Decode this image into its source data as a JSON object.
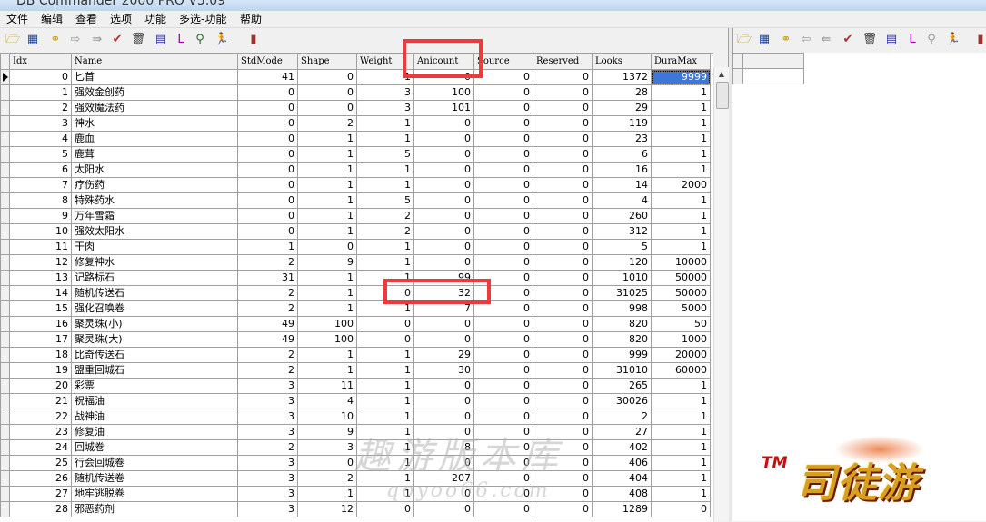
{
  "window": {
    "title": "DB Commander 2000 PRO V5.09"
  },
  "menu": [
    "文件",
    "编辑",
    "查看",
    "选项",
    "功能",
    "多选-功能",
    "帮助"
  ],
  "toolbar_left": [
    {
      "name": "open-folder-icon",
      "glyph": "🗁",
      "color": "#b8860b"
    },
    {
      "name": "grid-view-icon",
      "glyph": "▦",
      "color": "#1f3f8f"
    },
    {
      "name": "binoculars-icon",
      "glyph": "⚭",
      "color": "#c7a400"
    },
    {
      "name": "arrow-right-icon",
      "glyph": "⇨",
      "color": "#999999"
    },
    {
      "name": "export-icon",
      "glyph": "⇛",
      "color": "#999999"
    },
    {
      "name": "checklist-icon",
      "glyph": "✔",
      "color": "#b03030"
    },
    {
      "name": "trash-icon",
      "glyph": "🗑",
      "color": "#333333"
    },
    {
      "name": "database-icon",
      "glyph": "▤",
      "color": "#3030a0"
    },
    {
      "name": "letter-l-icon",
      "glyph": "L",
      "color": "#a000a0"
    },
    {
      "name": "search-key-icon",
      "glyph": "⚲",
      "color": "#2a6a2a"
    },
    {
      "name": "running-man-icon",
      "glyph": "🏃",
      "color": "#10a010"
    },
    {
      "name": "exit-door-icon",
      "glyph": "▮",
      "color": "#a03030"
    }
  ],
  "toolbar_right": [
    {
      "name": "open-folder-icon",
      "glyph": "🗁",
      "color": "#b8860b"
    },
    {
      "name": "grid-view-icon",
      "glyph": "▦",
      "color": "#1f3f8f"
    },
    {
      "name": "binoculars-icon",
      "glyph": "⚭",
      "color": "#c7a400"
    },
    {
      "name": "arrow-left-icon",
      "glyph": "⇦",
      "color": "#999999"
    },
    {
      "name": "import-icon",
      "glyph": "⇚",
      "color": "#999999"
    },
    {
      "name": "checklist-icon",
      "glyph": "✔",
      "color": "#b03030"
    },
    {
      "name": "trash-icon",
      "glyph": "🗑",
      "color": "#333333"
    },
    {
      "name": "database-icon",
      "glyph": "▤",
      "color": "#3030a0"
    },
    {
      "name": "letter-l-icon",
      "glyph": "L",
      "color": "#a000a0"
    },
    {
      "name": "search-key-icon",
      "glyph": "⚲",
      "color": "#999999"
    },
    {
      "name": "running-man-icon",
      "glyph": "🏃",
      "color": "#10a010"
    },
    {
      "name": "exit-door-icon",
      "glyph": "▮",
      "color": "#a03030"
    }
  ],
  "table": {
    "columns": [
      "Idx",
      "Name",
      "StdMode",
      "Shape",
      "Weight",
      "Anicount",
      "Source",
      "Reserved",
      "Looks",
      "DuraMax"
    ],
    "rows": [
      [
        "0",
        "匕首",
        "41",
        "0",
        "1",
        "0",
        "0",
        "0",
        "1372",
        "9999"
      ],
      [
        "1",
        "强效金创药",
        "0",
        "0",
        "3",
        "100",
        "0",
        "0",
        "28",
        "1"
      ],
      [
        "2",
        "强效魔法药",
        "0",
        "0",
        "3",
        "101",
        "0",
        "0",
        "29",
        "1"
      ],
      [
        "3",
        "神水",
        "0",
        "2",
        "1",
        "0",
        "0",
        "0",
        "119",
        "1"
      ],
      [
        "4",
        "鹿血",
        "0",
        "1",
        "1",
        "0",
        "0",
        "0",
        "23",
        "1"
      ],
      [
        "5",
        "鹿茸",
        "0",
        "1",
        "5",
        "0",
        "0",
        "0",
        "6",
        "1"
      ],
      [
        "6",
        "太阳水",
        "0",
        "1",
        "1",
        "0",
        "0",
        "0",
        "16",
        "1"
      ],
      [
        "7",
        "疗伤药",
        "0",
        "1",
        "1",
        "0",
        "0",
        "0",
        "14",
        "2000"
      ],
      [
        "8",
        "特殊药水",
        "0",
        "1",
        "5",
        "0",
        "0",
        "0",
        "4",
        "1"
      ],
      [
        "9",
        "万年雪霜",
        "0",
        "1",
        "2",
        "0",
        "0",
        "0",
        "260",
        "1"
      ],
      [
        "10",
        "强效太阳水",
        "0",
        "1",
        "2",
        "0",
        "0",
        "0",
        "312",
        "1"
      ],
      [
        "11",
        "干肉",
        "1",
        "0",
        "1",
        "0",
        "0",
        "0",
        "5",
        "1"
      ],
      [
        "12",
        "修复神水",
        "2",
        "9",
        "1",
        "0",
        "0",
        "0",
        "120",
        "10000"
      ],
      [
        "13",
        "记路标石",
        "31",
        "1",
        "1",
        "99",
        "0",
        "0",
        "1010",
        "50000"
      ],
      [
        "14",
        "随机传送石",
        "2",
        "1",
        "0",
        "32",
        "0",
        "0",
        "31025",
        "50000"
      ],
      [
        "15",
        "强化召唤卷",
        "2",
        "1",
        "1",
        "7",
        "0",
        "0",
        "998",
        "5000"
      ],
      [
        "16",
        "聚灵珠(小)",
        "49",
        "100",
        "0",
        "0",
        "0",
        "0",
        "820",
        "50"
      ],
      [
        "17",
        "聚灵珠(大)",
        "49",
        "100",
        "0",
        "0",
        "0",
        "0",
        "820",
        "1000"
      ],
      [
        "18",
        "比奇传送石",
        "2",
        "1",
        "1",
        "29",
        "0",
        "0",
        "999",
        "20000"
      ],
      [
        "19",
        "盟重回城石",
        "2",
        "1",
        "1",
        "30",
        "0",
        "0",
        "31010",
        "60000"
      ],
      [
        "20",
        "彩票",
        "3",
        "11",
        "1",
        "0",
        "0",
        "0",
        "265",
        "1"
      ],
      [
        "21",
        "祝福油",
        "3",
        "4",
        "1",
        "0",
        "0",
        "0",
        "30026",
        "1"
      ],
      [
        "22",
        "战神油",
        "3",
        "10",
        "1",
        "0",
        "0",
        "0",
        "2",
        "1"
      ],
      [
        "23",
        "修复油",
        "3",
        "9",
        "1",
        "0",
        "0",
        "0",
        "27",
        "1"
      ],
      [
        "24",
        "回城卷",
        "2",
        "3",
        "1",
        "8",
        "0",
        "0",
        "402",
        "1"
      ],
      [
        "25",
        "行会回城卷",
        "3",
        "0",
        "1",
        "0",
        "0",
        "0",
        "406",
        "1"
      ],
      [
        "26",
        "随机传送卷",
        "3",
        "2",
        "1",
        "207",
        "0",
        "0",
        "404",
        "1"
      ],
      [
        "27",
        "地牢逃脱卷",
        "3",
        "1",
        "1",
        "0",
        "0",
        "0",
        "408",
        "1"
      ],
      [
        "28",
        "邪恶药剂",
        "3",
        "12",
        "0",
        "0",
        "0",
        "0",
        "1289",
        "0"
      ]
    ],
    "selected": {
      "row": 0,
      "col": 9
    }
  },
  "watermark": {
    "line1": "趣游版本库",
    "line2": "qoyoo66.com"
  },
  "logo": {
    "tm": "TM",
    "text": "司徒游"
  },
  "colors": {
    "highlight": "#ee3a3a",
    "selection": "#3b78d8"
  }
}
